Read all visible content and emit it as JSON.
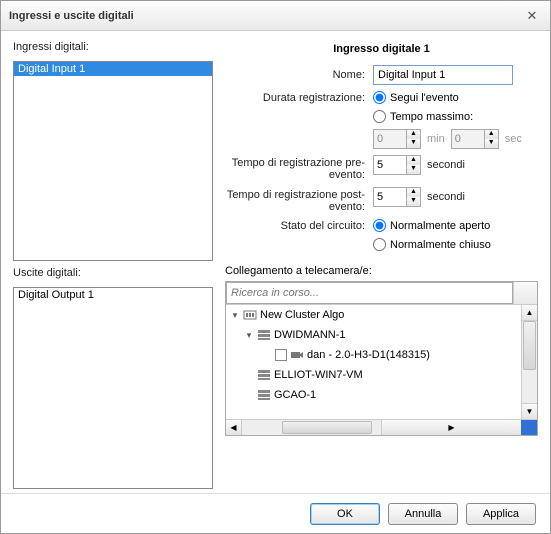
{
  "window": {
    "title": "Ingressi e uscite digitali"
  },
  "left": {
    "inputs_label": "Ingressi digitali:",
    "inputs": [
      "Digital Input 1"
    ],
    "outputs_label": "Uscite digitali:",
    "outputs": [
      "Digital Output 1"
    ]
  },
  "right": {
    "heading": "Ingresso digitale 1",
    "name_label": "Nome:",
    "name_value": "Digital Input 1",
    "rec_duration_label": "Durata registrazione:",
    "follow_event_label": "Segui l'evento",
    "max_time_label": "Tempo massimo:",
    "max_min_value": "0",
    "max_min_unit": "min",
    "max_sec_value": "0",
    "max_sec_unit": "sec",
    "pre_label": "Tempo di registrazione pre-evento:",
    "pre_value": "5",
    "post_label": "Tempo di registrazione post-evento:",
    "post_value": "5",
    "seconds_unit": "secondi",
    "circuit_label": "Stato del circuito:",
    "norm_open_label": "Normalmente aperto",
    "norm_closed_label": "Normalmente chiuso",
    "cam_section_label": "Collegamento a telecamera/e:",
    "search_placeholder": "Ricerca in corso...",
    "tree": {
      "root": "New Cluster Algo",
      "children": [
        {
          "name": "DWIDMANN-1",
          "expanded": true,
          "children": [
            {
              "name": "dan - 2.0-H3-D1(148315)",
              "camera": true
            }
          ]
        },
        {
          "name": "ELLIOT-WIN7-VM"
        },
        {
          "name": "GCAO-1"
        }
      ]
    }
  },
  "footer": {
    "ok": "OK",
    "cancel": "Annulla",
    "apply": "Applica"
  }
}
